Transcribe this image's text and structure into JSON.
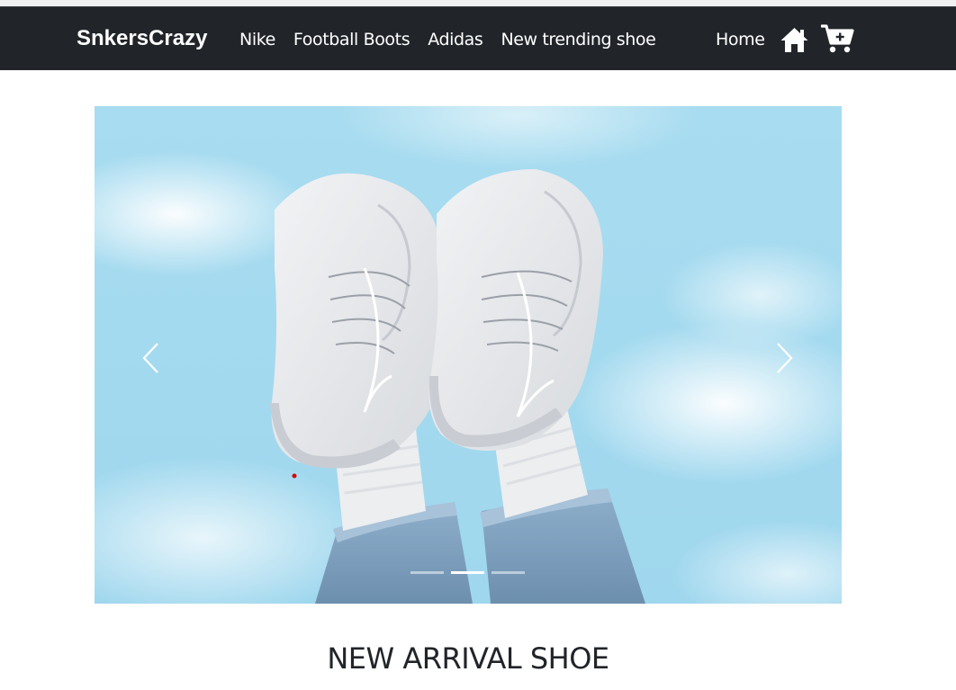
{
  "navbar": {
    "brand": "SnkersCrazy",
    "links": [
      {
        "label": "Nike"
      },
      {
        "label": "Football Boots"
      },
      {
        "label": "Adidas"
      },
      {
        "label": "New trending shoe"
      }
    ],
    "home_label": "Home",
    "icons": [
      "home-icon",
      "cart-icon"
    ],
    "background": "#212529"
  },
  "carousel": {
    "slide_count": 3,
    "active_index": 1,
    "image_alt": "white sneakers against blue sky",
    "controls": [
      "prev-arrow",
      "next-arrow"
    ]
  },
  "main": {
    "heading": "NEW ARRIVAL SHOE"
  }
}
